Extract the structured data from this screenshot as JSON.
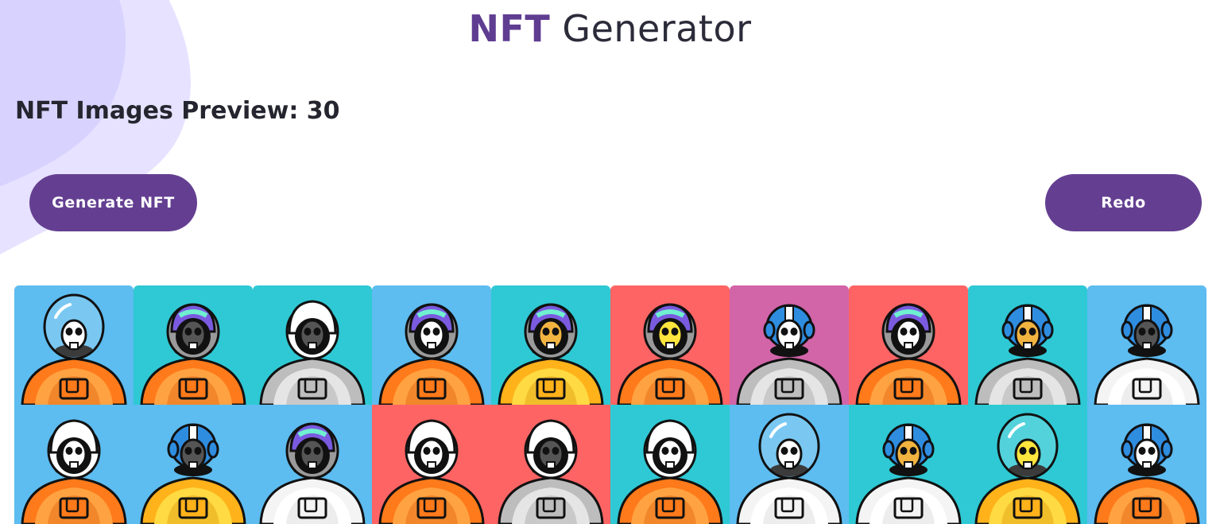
{
  "header": {
    "title_accent": "NFT",
    "title_rest": "Generator"
  },
  "preview": {
    "label": "NFT Images Preview: 30"
  },
  "actions": {
    "generate_label": "Generate NFT",
    "redo_label": "Redo"
  },
  "colors": {
    "brand": "#643f91",
    "blob": "#dcd6ff"
  },
  "nfts": [
    {
      "bg": "#5dbcf0",
      "suit": "#ff7a1a",
      "helmet": "bubble",
      "face": "#ffffff"
    },
    {
      "bg": "#2ec9d4",
      "suit": "#ff7a1a",
      "helmet": "holo",
      "face": "#555555"
    },
    {
      "bg": "#2ec9d4",
      "suit": "#bdbdbd",
      "helmet": "white",
      "face": "#555555"
    },
    {
      "bg": "#5dbcf0",
      "suit": "#ff7a1a",
      "helmet": "holo",
      "face": "#ffffff"
    },
    {
      "bg": "#2ec9d4",
      "suit": "#ffb21a",
      "helmet": "holo",
      "face": "#f2b440"
    },
    {
      "bg": "#ff6464",
      "suit": "#ff7a1a",
      "helmet": "holo",
      "face": "#ffe53d"
    },
    {
      "bg": "#d264a8",
      "suit": "#bdbdbd",
      "helmet": "blue",
      "face": "#ffffff"
    },
    {
      "bg": "#ff6464",
      "suit": "#ff7a1a",
      "helmet": "holo",
      "face": "#ffffff"
    },
    {
      "bg": "#2ec9d4",
      "suit": "#bdbdbd",
      "helmet": "blue",
      "face": "#f2b440"
    },
    {
      "bg": "#5dbcf0",
      "suit": "#f4f4f4",
      "helmet": "blue",
      "face": "#555555"
    },
    {
      "bg": "#5dbcf0",
      "suit": "#ff7a1a",
      "helmet": "white",
      "face": "#ffffff"
    },
    {
      "bg": "#5dbcf0",
      "suit": "#ffb21a",
      "helmet": "blue",
      "face": "#555555"
    },
    {
      "bg": "#5dbcf0",
      "suit": "#f4f4f4",
      "helmet": "holo",
      "face": "#555555"
    },
    {
      "bg": "#ff6464",
      "suit": "#ff7a1a",
      "helmet": "white",
      "face": "#ffffff"
    },
    {
      "bg": "#ff6464",
      "suit": "#bdbdbd",
      "helmet": "white",
      "face": "#555555"
    },
    {
      "bg": "#2ec9d4",
      "suit": "#ff7a1a",
      "helmet": "white",
      "face": "#ffffff"
    },
    {
      "bg": "#5dbcf0",
      "suit": "#f4f4f4",
      "helmet": "bubble",
      "face": "#ffffff"
    },
    {
      "bg": "#2ec9d4",
      "suit": "#f4f4f4",
      "helmet": "blue",
      "face": "#f2b440"
    },
    {
      "bg": "#2ec9d4",
      "suit": "#ffb21a",
      "helmet": "bubble",
      "face": "#ffe53d"
    },
    {
      "bg": "#5dbcf0",
      "suit": "#ff7a1a",
      "helmet": "blue",
      "face": "#ffffff"
    }
  ]
}
